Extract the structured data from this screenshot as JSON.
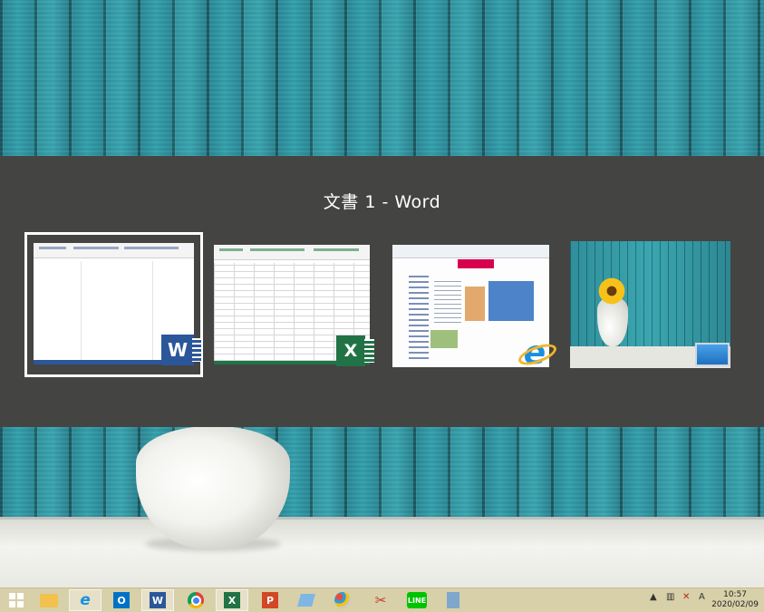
{
  "switcher": {
    "title": "文書 1 - Word",
    "thumbnails": [
      {
        "app": "Word",
        "badge_letter": "W",
        "badge_color": "#2b579a",
        "selected": true
      },
      {
        "app": "Excel",
        "badge_letter": "X",
        "badge_color": "#217346",
        "selected": false
      },
      {
        "app": "Internet Explorer",
        "badge_letter": "e",
        "badge_color": "#1a8fe0",
        "selected": false
      },
      {
        "app": "Desktop",
        "badge_icon": "desktop-icon",
        "selected": false
      }
    ]
  },
  "taskbar": {
    "items": [
      {
        "name": "start",
        "icon": "windows-logo-icon"
      },
      {
        "name": "file-explorer",
        "icon": "folder-icon"
      },
      {
        "name": "internet-explorer",
        "icon": "ie-icon",
        "label": "e",
        "active": true
      },
      {
        "name": "outlook",
        "icon": "outlook-icon",
        "label": "O"
      },
      {
        "name": "word",
        "icon": "word-icon",
        "label": "W",
        "active": true
      },
      {
        "name": "chrome",
        "icon": "chrome-icon"
      },
      {
        "name": "excel",
        "icon": "excel-icon",
        "label": "X",
        "active": true
      },
      {
        "name": "powerpoint",
        "icon": "powerpoint-icon",
        "label": "P"
      },
      {
        "name": "notepad",
        "icon": "notepad-icon"
      },
      {
        "name": "paint",
        "icon": "paint-icon"
      },
      {
        "name": "snipping-tool",
        "icon": "scissors-icon",
        "label": "✂"
      },
      {
        "name": "line",
        "icon": "line-icon",
        "label": "LINE"
      },
      {
        "name": "calculator",
        "icon": "calculator-icon"
      }
    ],
    "tray": {
      "ime": "A",
      "time": "10:57",
      "date": "2020/02/09"
    }
  },
  "colors": {
    "switcher_bg": "#444443",
    "taskbar_bg": "#d8d0a9",
    "selected_border": "#ffffff"
  }
}
